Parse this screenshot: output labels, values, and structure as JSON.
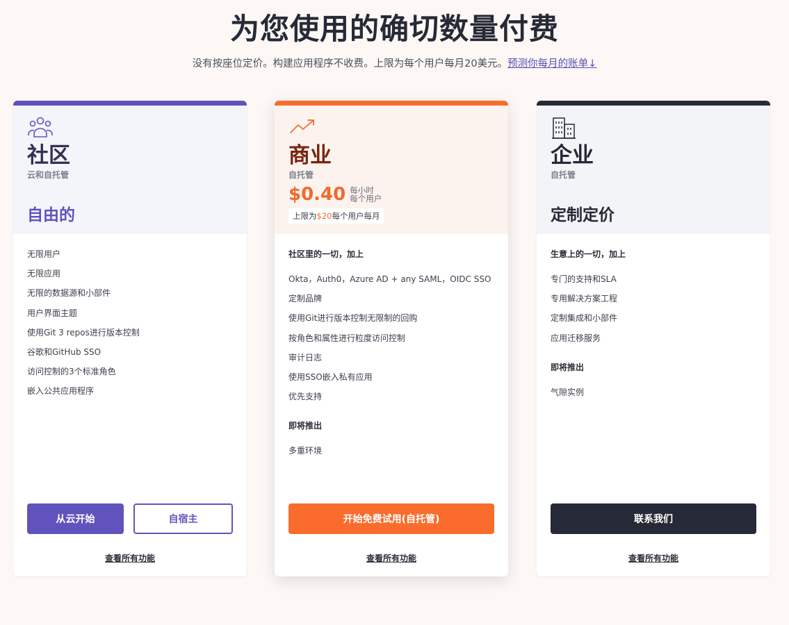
{
  "hero": {
    "title": "为您使用的确切数量付费",
    "subtitle": "没有按座位定价。构建应用程序不收费。上限为每个用户每月20美元。",
    "link": "预测你每月的账单↓"
  },
  "colors": {
    "purple": "#6053be",
    "orange": "#f96c2c",
    "dark": "#262a36"
  },
  "plans": {
    "community": {
      "icon": "users-group-icon",
      "name": "社区",
      "host": "云和自托管",
      "price": "自由的",
      "features": [
        "无限用户",
        "无限应用",
        "无限的数据源和小部件",
        "用户界面主题",
        "使用Git 3 repos进行版本控制",
        "谷歌和GitHub SSO",
        "访问控制的3个标准角色",
        "嵌入公共应用程序"
      ],
      "buttons": [
        "从云开始",
        "自宿主"
      ],
      "all_features": "查看所有功能"
    },
    "business": {
      "icon": "trending-up-icon",
      "name": "商业",
      "host": "自托管",
      "price_num": "$0.40",
      "price_unit_1": "每小时",
      "price_unit_2": "每个用户",
      "cap_prefix": "上限为",
      "cap_amount": "$20",
      "cap_suffix": "每个用户每月",
      "features_head": "社区里的一切，加上",
      "features": [
        "Okta，Auth0，Azure AD + any SAML，OIDC SSO",
        "定制品牌",
        "使用Git进行版本控制无限制的回购",
        "按角色和属性进行粒度访问控制",
        "审计日志",
        "使用SSO嵌入私有应用",
        "优先支持"
      ],
      "soon_head": "即将推出",
      "soon": [
        "多重环境"
      ],
      "button": "开始免费试用(自托管)",
      "all_features": "查看所有功能"
    },
    "enterprise": {
      "icon": "building-icon",
      "name": "企业",
      "host": "自托管",
      "price": "定制定价",
      "features_head": "生意上的一切，加上",
      "features": [
        "专门的支持和SLA",
        "专用解决方案工程",
        "定制集成和小部件",
        "应用迁移服务"
      ],
      "soon_head": "即将推出",
      "soon": [
        "气隙实例"
      ],
      "button": "联系我们",
      "all_features": "查看所有功能"
    }
  }
}
